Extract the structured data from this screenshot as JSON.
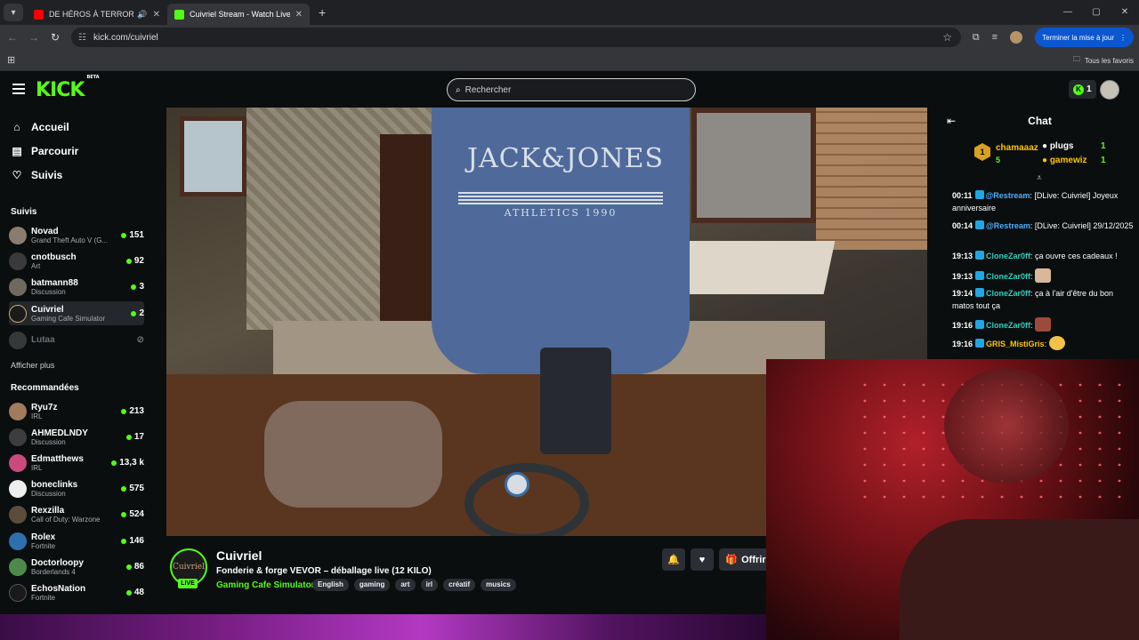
{
  "browser": {
    "tabs": [
      {
        "title": "DE HÉROS À TERRORISTE E",
        "active": false,
        "favicon_color": "#ff0000"
      },
      {
        "title": "Cuivriel Stream - Watch Live on",
        "active": true,
        "favicon_color": "#53fc18"
      }
    ],
    "url": "kick.com/cuivriel",
    "update_button": "Terminer la mise à jour",
    "all_favorites": "Tous les favoris"
  },
  "header": {
    "logo": "KICK",
    "logo_badge": "BETA",
    "search_placeholder": "Rechercher",
    "points": "1"
  },
  "sidebar": {
    "nav": [
      {
        "label": "Accueil",
        "icon": "home-icon"
      },
      {
        "label": "Parcourir",
        "icon": "browse-icon"
      },
      {
        "label": "Suivis",
        "icon": "heart-icon"
      }
    ],
    "followed_title": "Suivis",
    "followed": [
      {
        "name": "Novad",
        "category": "Grand Theft Auto V (G...",
        "viewers": "151",
        "color": "#8a7d70"
      },
      {
        "name": "cnotbusch",
        "category": "Art",
        "viewers": "92",
        "color": "#3a3a3a"
      },
      {
        "name": "batmann88",
        "category": "Discussion",
        "viewers": "3",
        "color": "#6f6a5e"
      },
      {
        "name": "Cuivriel",
        "category": "Gaming Cafe Simulator",
        "viewers": "2",
        "color": "#1b1b1b"
      },
      {
        "name": "Lutaa",
        "category": "",
        "viewers": "",
        "color": "#777777"
      }
    ],
    "show_more": "Afficher plus",
    "recommended_title": "Recommandées",
    "recommended": [
      {
        "name": "Ryu7z",
        "category": "IRL",
        "viewers": "213",
        "color": "#a27a5e"
      },
      {
        "name": "AHMEDLNDY",
        "category": "Discussion",
        "viewers": "17",
        "color": "#3d3d3d"
      },
      {
        "name": "Edmatthews",
        "category": "IRL",
        "viewers": "13,3 k",
        "color": "#c94b7d"
      },
      {
        "name": "boneclinks",
        "category": "Discussion",
        "viewers": "575",
        "color": "#eeeeee"
      },
      {
        "name": "Rexzilla",
        "category": "Call of Duty: Warzone",
        "viewers": "524",
        "color": "#5b4c3e"
      },
      {
        "name": "Rolex",
        "category": "Fortnite",
        "viewers": "146",
        "color": "#2f6fb0"
      },
      {
        "name": "Doctorloopy",
        "category": "Borderlands 4",
        "viewers": "86",
        "color": "#4d8a4a"
      },
      {
        "name": "EchosNation",
        "category": "Fortnite",
        "viewers": "48",
        "color": "#1a1a1a"
      }
    ]
  },
  "video": {
    "hoodie_text": "JACK&JONES",
    "hoodie_sub": "ATHLETICS 1990"
  },
  "stream": {
    "avatar_text": "Cuivriel",
    "live": "LIVE",
    "channel": "Cuivriel",
    "title": "Fonderie & forge VEVOR – déballage live (12 KILO)",
    "category": "Gaming Cafe Simulator",
    "tags": [
      "English",
      "gaming",
      "art",
      "irl",
      "créatif",
      "musics"
    ],
    "gift_label": "Offrir"
  },
  "chat": {
    "title": "Chat",
    "top_gifter": {
      "rank": "1",
      "name": "chamaaaz",
      "count": "5"
    },
    "gifters": [
      {
        "name": "plugs",
        "count": "1"
      },
      {
        "name": "gamewiz",
        "count": "1"
      }
    ],
    "messages": [
      {
        "time": "00:11",
        "user": "@Restream",
        "user_color": "#4fb0ff",
        "text": ": [DLive: Cuivriel] Joyeux anniversaire"
      },
      {
        "time": "00:14",
        "user": "@Restream",
        "user_color": "#4fb0ff",
        "text": ": [DLive: Cuivriel] 29/12/2025"
      },
      {
        "time": "19:13",
        "user": "CloneZar0ff",
        "user_color": "#2fd0c0",
        "text": ": ça ouvre ces cadeaux !"
      },
      {
        "time": "19:13",
        "user": "CloneZar0ff",
        "user_color": "#2fd0c0",
        "text": ":"
      },
      {
        "time": "19:14",
        "user": "CloneZar0ff",
        "user_color": "#2fd0c0",
        "text": ": ça à l'air d'être du bon matos tout ça"
      },
      {
        "time": "19:16",
        "user": "CloneZar0ff",
        "user_color": "#2fd0c0",
        "text": ":"
      },
      {
        "time": "19:16",
        "user": "GRIS_MistiGris",
        "user_color": "#ffc400",
        "text": ":"
      }
    ]
  }
}
